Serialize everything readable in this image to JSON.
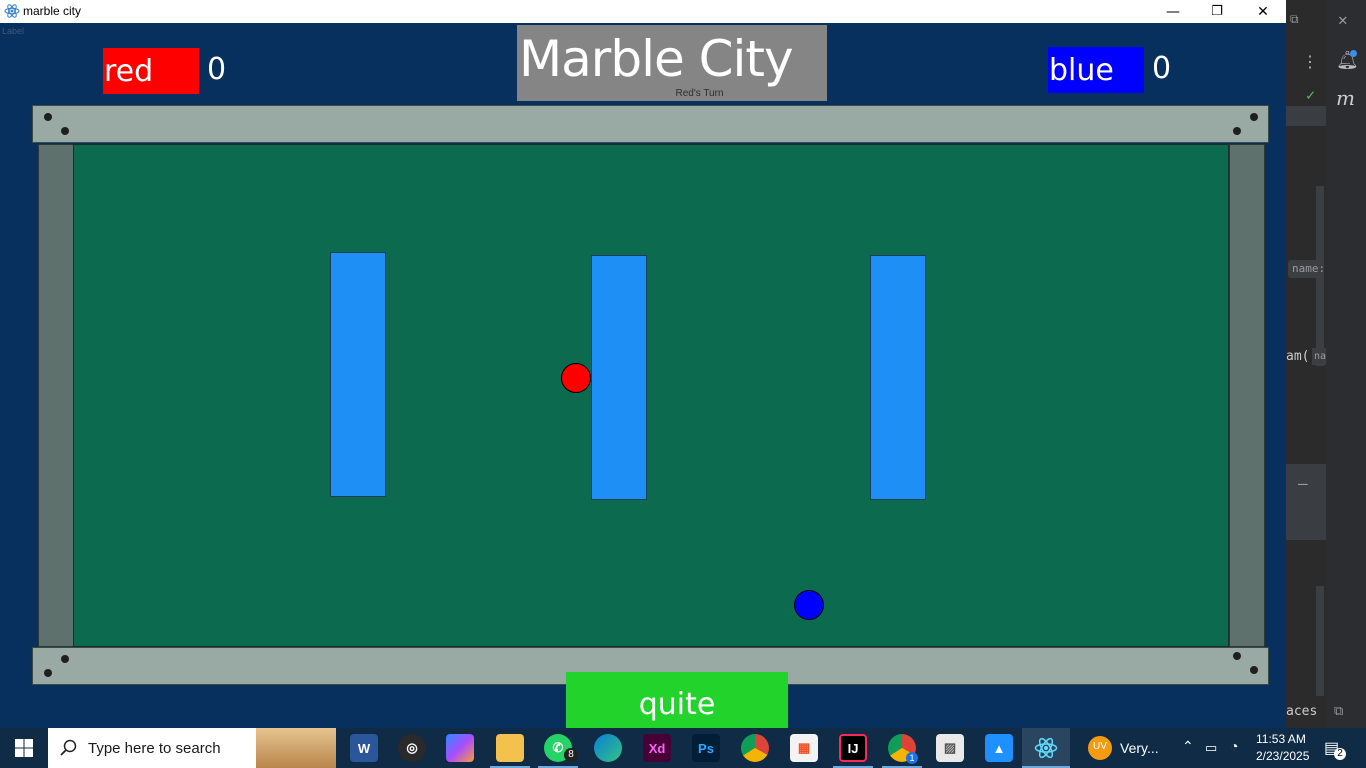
{
  "window": {
    "title": "marble city",
    "minimize_glyph": "—",
    "maximize_glyph": "❐",
    "close_glyph": "✕",
    "label_text": "Label"
  },
  "game": {
    "title": "Marble City",
    "turn_text": "Red's Turn",
    "players": [
      {
        "name": "red",
        "score": "0",
        "color": "#ff0000"
      },
      {
        "name": "blue",
        "score": "0",
        "color": "#0000ff"
      }
    ],
    "quit_label": "quite"
  },
  "ide_background": {
    "snippets": [
      "name:",
      "am(",
      "na",
      "aces"
    ],
    "letter_m": "m"
  },
  "taskbar": {
    "search_placeholder": "Type here to search",
    "whatsapp_badge": "8",
    "chrome_badge": "1",
    "user_initials": "UV",
    "user_app_label": "Very...",
    "time": "11:53 AM",
    "date": "2/23/2025",
    "notification_count": "2",
    "icons": [
      "windows-start",
      "search",
      "word",
      "obs",
      "copilot",
      "file-explorer",
      "whatsapp",
      "edge",
      "adobe-xd",
      "photoshop",
      "chrome",
      "microsoft-store",
      "intellij",
      "chrome-profile",
      "photos",
      "paint",
      "react"
    ],
    "icon_colors": {
      "word": "#2b579a",
      "xd": "#470137",
      "ps": "#001e36",
      "ij": "#000000"
    }
  }
}
